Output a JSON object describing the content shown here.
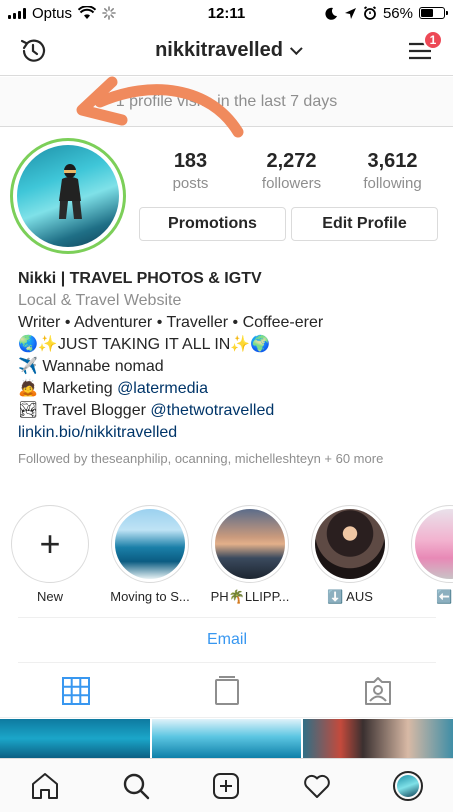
{
  "status_bar": {
    "carrier": "Optus",
    "time": "12:11",
    "battery": "56%",
    "battery_level": 0.56
  },
  "header": {
    "username": "nikkitravelled",
    "notification_count": "1"
  },
  "banner": {
    "visits_text": "1 profile visits in the last 7 days"
  },
  "stats": [
    {
      "value": "183",
      "label": "posts"
    },
    {
      "value": "2,272",
      "label": "followers"
    },
    {
      "value": "3,612",
      "label": "following"
    }
  ],
  "buttons": {
    "promotions": "Promotions",
    "edit_profile": "Edit Profile"
  },
  "bio": {
    "name": "Nikki | TRAVEL PHOTOS & IGTV",
    "category": "Local & Travel Website",
    "line1": "Writer • Adventurer • Traveller • Coffee-erer",
    "line2": "🌏✨JUST TAKING IT ALL IN✨🌍",
    "line3": "✈️ Wannabe nomad",
    "line4_prefix": "🙇 Marketing ",
    "line4_link": "@latermedia",
    "line5_prefix": "🏞 Travel Blogger ",
    "line5_link": "@thetwotravelled",
    "link": "linkin.bio/nikkitravelled",
    "followed_by": "Followed by theseanphilip, ocanning, michelleshteyn + 60 more"
  },
  "highlights": [
    {
      "label": "New"
    },
    {
      "label": "Moving to S..."
    },
    {
      "label": "PH🌴LLIPP..."
    },
    {
      "label": "⬇️ AUS"
    },
    {
      "label": "⬅️ A"
    }
  ],
  "email": "Email",
  "colors": {
    "accent": "#3897f0",
    "link": "#003569",
    "badge": "#ed4956",
    "story_ring": "#7ccf59",
    "arrow": "#f08a5d"
  }
}
